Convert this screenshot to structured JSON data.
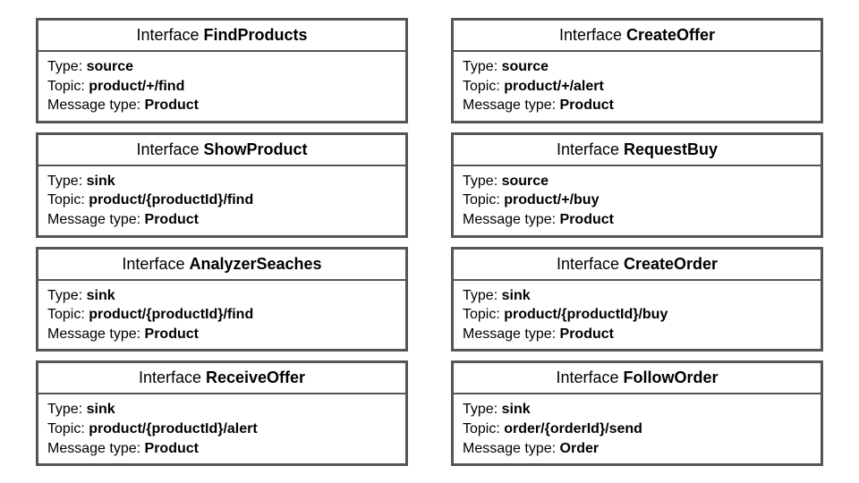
{
  "labels": {
    "interface_prefix": "Interface",
    "type": "Type:",
    "topic": "Topic:",
    "msgtype": "Message type:"
  },
  "cards": [
    {
      "name": "FindProducts",
      "type": "source",
      "topic": "product/+/find",
      "msgtype": "Product"
    },
    {
      "name": "CreateOffer",
      "type": "source",
      "topic": "product/+/alert",
      "msgtype": "Product"
    },
    {
      "name": "ShowProduct",
      "type": "sink",
      "topic": "product/{productId}/find",
      "msgtype": "Product"
    },
    {
      "name": "RequestBuy",
      "type": "source",
      "topic": "product/+/buy",
      "msgtype": "Product"
    },
    {
      "name": "AnalyzerSeaches",
      "type": "sink",
      "topic": "product/{productId}/find",
      "msgtype": "Product"
    },
    {
      "name": "CreateOrder",
      "type": "sink",
      "topic": "product/{productId}/buy",
      "msgtype": "Product"
    },
    {
      "name": "ReceiveOffer",
      "type": "sink",
      "topic": "product/{productId}/alert",
      "msgtype": "Product"
    },
    {
      "name": "FollowOrder",
      "type": "sink",
      "topic": "order/{orderId}/send",
      "msgtype": "Order"
    }
  ]
}
